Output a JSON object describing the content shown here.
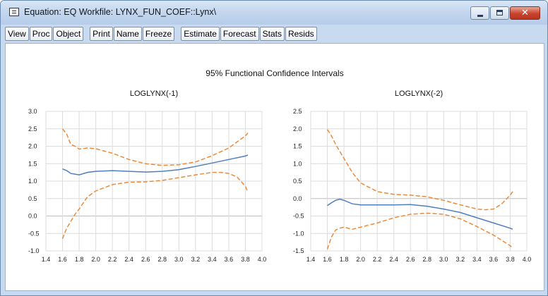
{
  "window": {
    "title": "Equation: EQ   Workfile: LYNX_FUN_COEF::Lynx\\",
    "close_glyph": "✕"
  },
  "toolbar": {
    "group1": [
      "View",
      "Proc",
      "Object"
    ],
    "group2": [
      "Print",
      "Name",
      "Freeze"
    ],
    "group3": [
      "Estimate",
      "Forecast",
      "Stats",
      "Resids"
    ]
  },
  "figure": {
    "title": "95% Functional Confidence Intervals"
  },
  "colors": {
    "estimate_line": "#4f7fc1",
    "interval_line": "#ec8a3a",
    "grid": "#dcdcdc",
    "zero_line": "#bdbdbd"
  },
  "chart_data": [
    {
      "type": "line",
      "title": "LOGLYNX(-1)",
      "xlim": [
        1.4,
        4.0
      ],
      "ylim": [
        -1.0,
        3.0
      ],
      "xticks": [
        "1.4",
        "1.6",
        "1.8",
        "2.0",
        "2.2",
        "2.4",
        "2.6",
        "2.8",
        "3.0",
        "3.2",
        "3.4",
        "3.6",
        "3.8",
        "4.0"
      ],
      "yticks": [
        "3.0",
        "2.5",
        "2.0",
        "1.5",
        "1.0",
        "0.5",
        "0.0",
        "-0.5",
        "-1.0"
      ],
      "grid": true,
      "series": [
        {
          "role": "estimate",
          "style": "solid",
          "x": [
            1.6,
            1.65,
            1.7,
            1.75,
            1.8,
            1.9,
            2.0,
            2.2,
            2.4,
            2.6,
            2.8,
            3.0,
            3.2,
            3.4,
            3.6,
            3.8,
            3.83
          ],
          "y": [
            1.35,
            1.3,
            1.22,
            1.2,
            1.18,
            1.25,
            1.28,
            1.3,
            1.28,
            1.26,
            1.28,
            1.33,
            1.42,
            1.52,
            1.62,
            1.72,
            1.75
          ]
        },
        {
          "role": "upper",
          "style": "dashed",
          "x": [
            1.6,
            1.65,
            1.7,
            1.75,
            1.8,
            1.9,
            2.0,
            2.2,
            2.4,
            2.6,
            2.8,
            3.0,
            3.2,
            3.4,
            3.6,
            3.8,
            3.83
          ],
          "y": [
            2.5,
            2.35,
            2.05,
            2.0,
            1.92,
            1.95,
            1.93,
            1.8,
            1.62,
            1.5,
            1.45,
            1.47,
            1.55,
            1.73,
            1.95,
            2.3,
            2.38
          ]
        },
        {
          "role": "lower",
          "style": "dashed",
          "x": [
            1.6,
            1.65,
            1.7,
            1.75,
            1.8,
            1.9,
            2.0,
            2.2,
            2.4,
            2.6,
            2.8,
            3.0,
            3.2,
            3.4,
            3.5,
            3.6,
            3.7,
            3.8,
            3.83
          ],
          "y": [
            -0.65,
            -0.35,
            -0.15,
            0.05,
            0.2,
            0.55,
            0.72,
            0.9,
            0.97,
            0.98,
            1.02,
            1.1,
            1.18,
            1.25,
            1.25,
            1.22,
            1.12,
            0.85,
            0.68
          ]
        }
      ]
    },
    {
      "type": "line",
      "title": "LOGLYNX(-2)",
      "xlim": [
        1.4,
        4.0
      ],
      "ylim": [
        -1.5,
        2.5
      ],
      "xticks": [
        "1.4",
        "1.6",
        "1.8",
        "2.0",
        "2.2",
        "2.4",
        "2.6",
        "2.8",
        "3.0",
        "3.2",
        "3.4",
        "3.6",
        "3.8",
        "4.0"
      ],
      "yticks": [
        "2.5",
        "2.0",
        "1.5",
        "1.0",
        "0.5",
        "0.0",
        "-0.5",
        "-1.0",
        "-1.5"
      ],
      "grid": true,
      "series": [
        {
          "role": "estimate",
          "style": "solid",
          "x": [
            1.6,
            1.65,
            1.7,
            1.75,
            1.8,
            1.9,
            2.0,
            2.2,
            2.4,
            2.6,
            2.8,
            3.0,
            3.2,
            3.4,
            3.6,
            3.8,
            3.83
          ],
          "y": [
            -0.2,
            -0.12,
            -0.05,
            -0.02,
            -0.05,
            -0.15,
            -0.18,
            -0.18,
            -0.18,
            -0.17,
            -0.22,
            -0.3,
            -0.4,
            -0.55,
            -0.7,
            -0.85,
            -0.88
          ]
        },
        {
          "role": "upper",
          "style": "dashed",
          "x": [
            1.6,
            1.65,
            1.7,
            1.8,
            1.9,
            2.0,
            2.2,
            2.4,
            2.6,
            2.8,
            3.0,
            3.2,
            3.4,
            3.5,
            3.6,
            3.7,
            3.8,
            3.83
          ],
          "y": [
            1.98,
            1.8,
            1.55,
            1.15,
            0.75,
            0.45,
            0.2,
            0.12,
            0.1,
            0.05,
            -0.05,
            -0.18,
            -0.3,
            -0.32,
            -0.3,
            -0.15,
            0.1,
            0.2
          ]
        },
        {
          "role": "lower",
          "style": "dashed",
          "x": [
            1.6,
            1.65,
            1.7,
            1.75,
            1.8,
            1.9,
            2.0,
            2.2,
            2.4,
            2.6,
            2.8,
            3.0,
            3.2,
            3.4,
            3.6,
            3.8,
            3.83
          ],
          "y": [
            -1.45,
            -1.1,
            -0.9,
            -0.85,
            -0.82,
            -0.88,
            -0.82,
            -0.7,
            -0.55,
            -0.45,
            -0.42,
            -0.45,
            -0.58,
            -0.8,
            -1.05,
            -1.35,
            -1.42
          ]
        }
      ]
    }
  ]
}
